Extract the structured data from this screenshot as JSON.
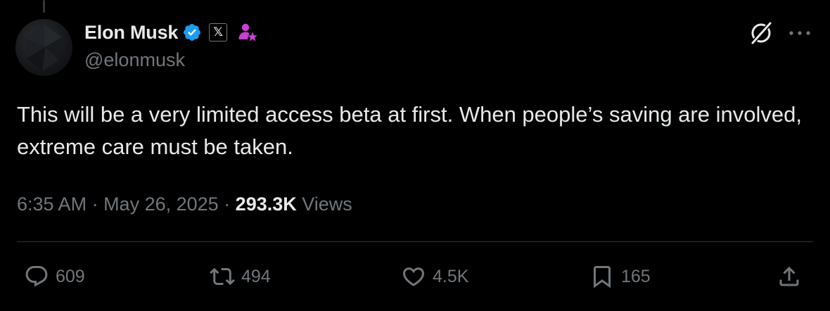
{
  "author": {
    "display_name": "Elon Musk",
    "handle": "@elonmusk",
    "verified_icon": "verified-badge-icon",
    "affiliate_badge": "𝕏",
    "extra_icon": "profile-star-icon"
  },
  "tweet": {
    "text": "This will be a very limited access beta at first. When people’s saving are involved, extreme care must be taken."
  },
  "meta": {
    "time": "6:35 AM",
    "separator": " · ",
    "date": "May 26, 2025",
    "views_count": "293.3K",
    "views_label": " Views"
  },
  "actions": {
    "replies": "609",
    "reposts": "494",
    "likes": "4.5K",
    "bookmarks": "165"
  },
  "colors": {
    "background": "#000000",
    "text_primary": "#e7e9ea",
    "text_secondary": "#71767b",
    "verified": "#1d9bf0",
    "affiliate_purple": "#c93fd3",
    "divider": "#2f3336"
  }
}
